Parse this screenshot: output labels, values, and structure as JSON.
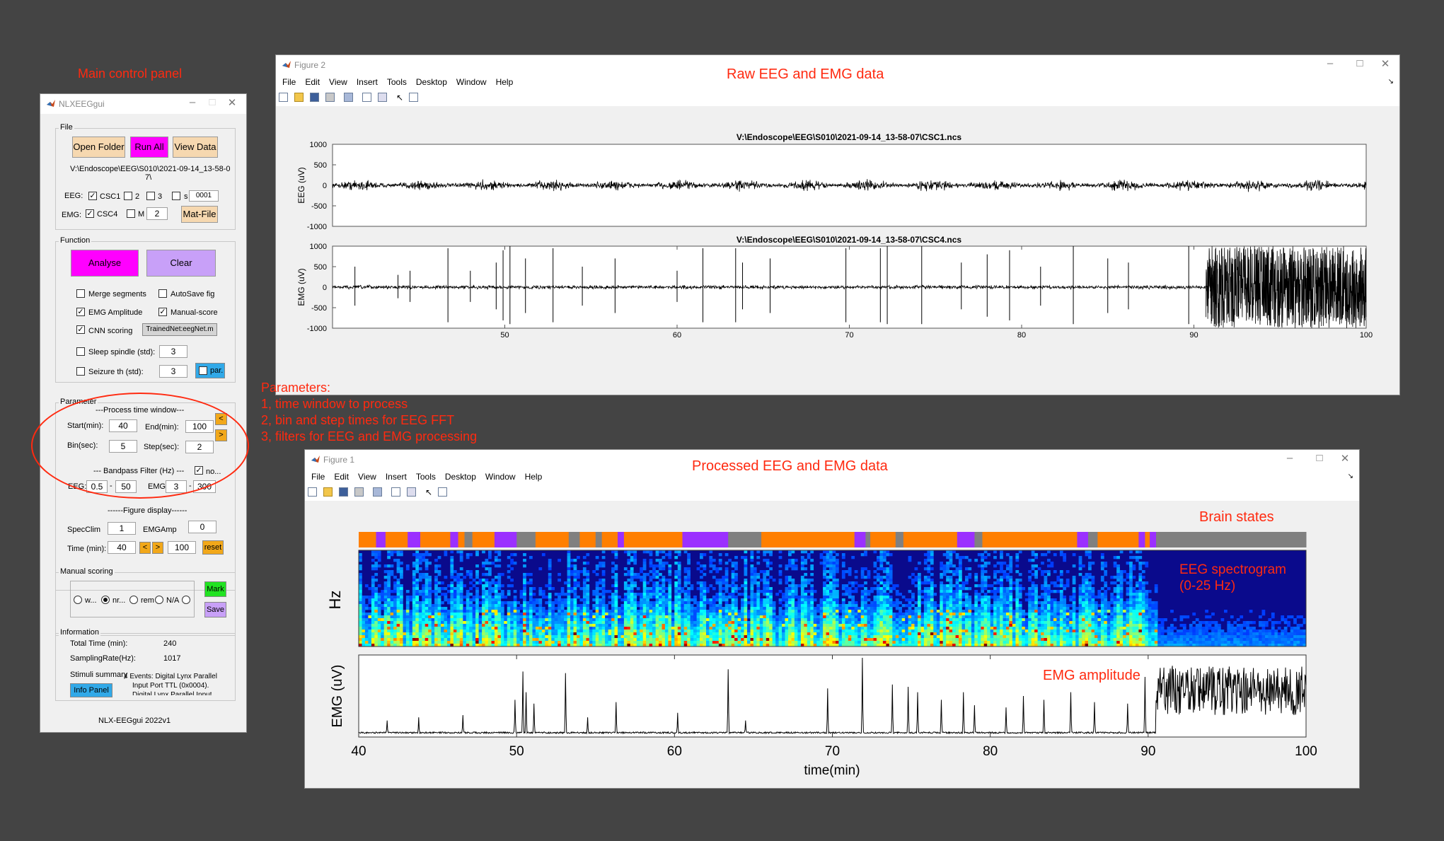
{
  "annotations": {
    "main_panel": "Main control panel",
    "raw": "Raw EEG and EMG data",
    "processed": "Processed EEG and EMG data",
    "params_lines": [
      "Parameters:",
      "1, time window to process",
      "2, bin and step times for EEG FFT",
      "3, filters for EEG and EMG processing"
    ],
    "brain_states": "Brain states",
    "spectrogram_lines": [
      "EEG spectrogram",
      "(0-25 Hz)"
    ],
    "emg_amp": "EMG amplitude"
  },
  "control_panel": {
    "title": "NLXEEGgui",
    "file_group": "File",
    "open_folder": "Open Folder",
    "run_all": "Run All",
    "view_data": "View Data",
    "path_lines": [
      "V:\\Endoscope\\EEG\\S010\\2021-09-14_13-58-0",
      "7\\"
    ],
    "eeg_label": "EEG:",
    "eeg_csc1": "CSC1",
    "eeg_2": "2",
    "eeg_3": "3",
    "eeg_s": "s",
    "eeg_s_value": "0001",
    "emg_label": "EMG:",
    "emg_csc4": "CSC4",
    "emg_m": "M",
    "emg_m_value": "2",
    "mat_file": "Mat-File",
    "function_group": "Function",
    "analyse": "Analyse",
    "clear": "Clear",
    "merge_segments": "Merge segments",
    "autosave_fig": "AutoSave fig",
    "emg_amplitude": "EMG Amplitude",
    "manual_score": "Manual-score",
    "cnn_scoring": "CNN scoring",
    "trained_net": "TrainedNet:eegNet.m",
    "sleep_spindle": "Sleep spindle (std):",
    "sleep_spindle_value": "3",
    "seizure_th": "Seizure th (std):",
    "seizure_th_value": "3",
    "par": "par.",
    "parameter_group": "Parameter",
    "process_window": "---Process time window---",
    "start_label": "Start(min):",
    "start_value": "40",
    "end_label": "End(min):",
    "end_value": "100",
    "bin_label": "Bin(sec):",
    "bin_value": "5",
    "step_label": "Step(sec):",
    "step_value": "2",
    "prev": "<",
    "next": ">",
    "bandpass": "--- Bandpass Filter (Hz) ---",
    "bandpass_no": "no...",
    "eeg_band_label": "EEG:",
    "eeg_low": "0.5",
    "eeg_high": "50",
    "emg_band_label": "EMG:",
    "emg_low": "3",
    "emg_high": "300",
    "dash": "-",
    "figure_display": "------Figure display------",
    "specclim_label": "SpecClim",
    "specclim_value": "1",
    "emgamp_label": "EMGAmp",
    "emgamp_value": "0",
    "time_label": "Time (min):",
    "time_start": "40",
    "time_end": "100",
    "reset": "reset",
    "manual_scoring_group": "Manual scoring",
    "radio_w": "w...",
    "radio_nr": "nr...",
    "radio_rem": "rem",
    "radio_na": "N/A",
    "mark": "Mark",
    "save": "Save",
    "information_group": "Information",
    "total_time_label": "Total Time (min):",
    "total_time_value": "240",
    "sampling_label": "SamplingRate(Hz):",
    "sampling_value": "1017",
    "stimuli_label": "Stimuli summary",
    "stimuli_lines": [
      "4 Events:  Digital Lynx Parallel",
      "Input Port TTL (0x0004).",
      "Digital Lynx Parallel Input"
    ],
    "info_panel": "Info Panel",
    "version": "NLX-EEGgui 2022v1"
  },
  "figure2": {
    "title": "Figure 2",
    "menu": [
      "File",
      "Edit",
      "View",
      "Insert",
      "Tools",
      "Desktop",
      "Window",
      "Help"
    ],
    "eeg_title": "V:\\Endoscope\\EEG\\S010\\2021-09-14_13-58-07\\CSC1.ncs",
    "emg_title": "V:\\Endoscope\\EEG\\S010\\2021-09-14_13-58-07\\CSC4.ncs",
    "eeg_ylabel": "EEG (uV)",
    "emg_ylabel": "EMG (uV)"
  },
  "figure1": {
    "title": "Figure 1",
    "menu": [
      "File",
      "Edit",
      "View",
      "Insert",
      "Tools",
      "Desktop",
      "Window",
      "Help"
    ],
    "hz_label": "Hz",
    "emg_ylabel": "EMG (uV)",
    "xlabel": "time(min)"
  },
  "chart_data": [
    {
      "type": "line",
      "name": "raw-eeg",
      "title": "V:\\Endoscope\\EEG\\S010\\2021-09-14_13-58-07\\CSC1.ncs",
      "ylabel": "EEG (uV)",
      "xlim": [
        40,
        100
      ],
      "ylim": [
        -1000,
        1000
      ],
      "yticks": [
        1000,
        500,
        0,
        -500,
        -1000
      ],
      "amplitude_uV": 150
    },
    {
      "type": "line",
      "name": "raw-emg",
      "title": "V:\\Endoscope\\EEG\\S010\\2021-09-14_13-58-07\\CSC4.ncs",
      "ylabel": "EMG (uV)",
      "xlim": [
        40,
        100
      ],
      "ylim": [
        -1000,
        1000
      ],
      "yticks": [
        1000,
        500,
        0,
        -500,
        -1000
      ],
      "xticks": [
        50,
        60,
        70,
        80,
        90,
        100
      ],
      "baseline_amplitude_uV": 60,
      "spike_times_min": [
        41.3,
        43.8,
        44.5,
        46.7,
        48.0,
        49.5,
        49.9,
        50.3,
        51.2,
        52.8,
        54.5,
        56.4,
        60.0,
        61.5,
        63.4,
        63.8,
        65.4,
        69.8,
        71.8,
        72.2,
        74.2,
        76.5,
        78.0,
        79.3,
        81.1,
        83.0,
        85.0,
        86.2,
        89.7
      ],
      "spike_heights_uV": [
        500,
        300,
        400,
        950,
        400,
        600,
        900,
        1000,
        700,
        950,
        500,
        700,
        400,
        950,
        950,
        600,
        700,
        950,
        950,
        1000,
        1000,
        600,
        800,
        900,
        500,
        1000,
        700,
        600,
        1000
      ],
      "high_activity_range_min": [
        90.7,
        100
      ],
      "high_activity_amplitude_uV": 1000
    },
    {
      "type": "heatmap",
      "name": "brain-states",
      "xlim": [
        40,
        100
      ],
      "state_colors": {
        "orange": "#ff7f00",
        "purple": "#9b30ff",
        "gray": "#808080"
      },
      "segments": [
        [
          40.0,
          41.1,
          "orange"
        ],
        [
          41.1,
          41.7,
          "purple"
        ],
        [
          41.7,
          43.1,
          "orange"
        ],
        [
          43.1,
          43.9,
          "purple"
        ],
        [
          43.9,
          44.1,
          "orange"
        ],
        [
          44.1,
          45.8,
          "orange"
        ],
        [
          45.8,
          46.3,
          "purple"
        ],
        [
          46.3,
          46.7,
          "orange"
        ],
        [
          46.7,
          47.2,
          "gray"
        ],
        [
          47.2,
          48.6,
          "orange"
        ],
        [
          48.6,
          50.0,
          "purple"
        ],
        [
          50.0,
          51.2,
          "gray"
        ],
        [
          51.2,
          53.3,
          "orange"
        ],
        [
          53.3,
          54.0,
          "gray"
        ],
        [
          54.0,
          55.0,
          "orange"
        ],
        [
          55.0,
          55.4,
          "gray"
        ],
        [
          55.4,
          56.4,
          "orange"
        ],
        [
          56.4,
          56.8,
          "purple"
        ],
        [
          56.8,
          60.5,
          "orange"
        ],
        [
          60.5,
          63.4,
          "purple"
        ],
        [
          63.4,
          65.5,
          "gray"
        ],
        [
          65.5,
          71.4,
          "orange"
        ],
        [
          71.4,
          72.1,
          "purple"
        ],
        [
          72.1,
          72.4,
          "gray"
        ],
        [
          72.4,
          74.0,
          "orange"
        ],
        [
          74.0,
          74.5,
          "gray"
        ],
        [
          74.5,
          77.9,
          "orange"
        ],
        [
          77.9,
          79.0,
          "purple"
        ],
        [
          79.0,
          79.5,
          "gray"
        ],
        [
          79.5,
          85.5,
          "orange"
        ],
        [
          85.5,
          86.2,
          "purple"
        ],
        [
          86.2,
          86.8,
          "gray"
        ],
        [
          86.8,
          89.4,
          "orange"
        ],
        [
          89.4,
          89.8,
          "purple"
        ],
        [
          89.8,
          90.1,
          "orange"
        ],
        [
          90.1,
          90.5,
          "purple"
        ],
        [
          90.5,
          100.0,
          "gray"
        ]
      ]
    },
    {
      "type": "heatmap",
      "name": "eeg-spectrogram",
      "ylabel": "Hz",
      "xlim": [
        40,
        100
      ],
      "ylim": [
        0,
        25
      ],
      "colormap": "jet",
      "low_power_range_min": [
        90.5,
        100
      ]
    },
    {
      "type": "line",
      "name": "emg-amplitude",
      "ylabel": "EMG (uV)",
      "xlabel": "time(min)",
      "xlim": [
        40,
        100
      ],
      "xticks": [
        40,
        50,
        60,
        70,
        80,
        90,
        100
      ],
      "peak_times_min": [
        41.8,
        43.8,
        46.6,
        49.9,
        50.4,
        50.6,
        51.1,
        53.1,
        54.5,
        56.3,
        60.2,
        63.4,
        64.5,
        69.7,
        71.9,
        73.8,
        74.8,
        75.4,
        76.9,
        78.3,
        79.0,
        81.0,
        82.1,
        83.4,
        85.1,
        86.6,
        88.7,
        89.8
      ],
      "peak_heights_rel": [
        0.18,
        0.22,
        0.25,
        0.45,
        0.82,
        0.55,
        0.4,
        0.8,
        0.22,
        0.42,
        0.28,
        0.85,
        0.18,
        0.6,
        1.0,
        0.65,
        0.62,
        0.55,
        0.45,
        0.55,
        0.38,
        0.35,
        0.5,
        0.45,
        0.55,
        0.42,
        0.4,
        0.75
      ],
      "high_activity_range_min": [
        90.5,
        100
      ]
    }
  ]
}
